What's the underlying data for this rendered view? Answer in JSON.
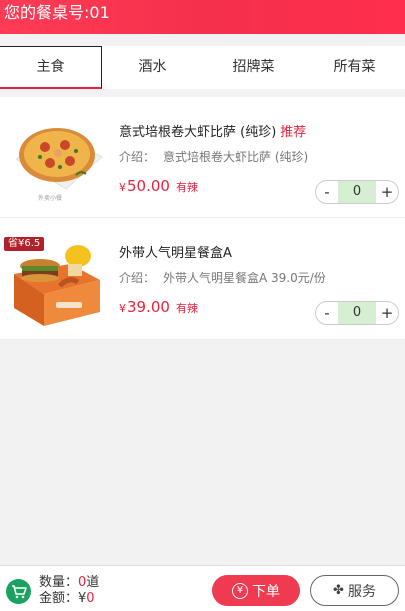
{
  "header": {
    "title": "您的餐桌号:01"
  },
  "tabs": [
    {
      "label": "主食"
    },
    {
      "label": "酒水"
    },
    {
      "label": "招牌菜"
    },
    {
      "label": "所有菜"
    }
  ],
  "items": [
    {
      "name": "意式培根卷大虾比萨 (纯珍)",
      "tag": "推荐",
      "intro_label": "介绍：",
      "intro": "意式培根卷大虾比萨 (纯珍)",
      "currency": "¥",
      "price": "50.00",
      "spicy": "有辣",
      "qty": "0",
      "minus": "-",
      "plus": "+",
      "image_caption": "外卖小餐"
    },
    {
      "name": "外带人气明星餐盒A",
      "intro_label": "介绍：",
      "intro": "外带人气明星餐盒A 39.0元/份",
      "currency": "¥",
      "price": "39.00",
      "spicy": "有辣",
      "qty": "0",
      "minus": "-",
      "plus": "+",
      "badge": "省¥6.5"
    }
  ],
  "footer": {
    "qty_label": "数量：",
    "qty_value": "0",
    "qty_unit": "道",
    "amount_label": "金额：¥",
    "amount_value": "0",
    "order_label": "下单",
    "service_label": "服务"
  },
  "colors": {
    "brand_red": "#f03a50",
    "accent_green": "#1aa35f",
    "stepper_green": "#d6efd2"
  },
  "icons": {
    "cart": "cart-icon",
    "order": "yen-coin-icon",
    "service": "service-icon"
  }
}
